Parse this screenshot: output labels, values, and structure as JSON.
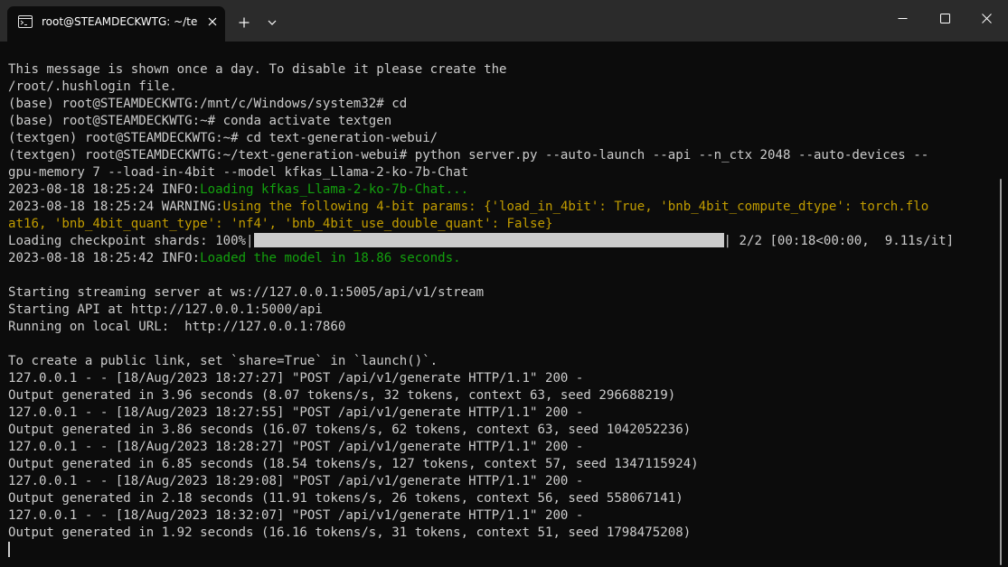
{
  "window": {
    "tab_title": "root@STEAMDECKWTG: ~/tex",
    "icons": {
      "tab": "terminal-icon",
      "close_tab": "close-icon",
      "new_tab": "plus-icon",
      "dropdown": "chevron-down-icon",
      "minimize": "minimize-icon",
      "maximize": "maximize-icon",
      "close_window": "close-icon"
    }
  },
  "terminal": {
    "colors": {
      "text": "#cccccc",
      "green": "#13a10e",
      "yellow": "#c19c00",
      "background": "#0c0c0c"
    },
    "lines": [
      {
        "t": "This message is shown once a day. To disable it please create the"
      },
      {
        "t": "/root/.hushlogin file."
      },
      {
        "t": "(base) root@STEAMDECKWTG:/mnt/c/Windows/system32# cd"
      },
      {
        "t": "(base) root@STEAMDECKWTG:~# conda activate textgen"
      },
      {
        "t": "(textgen) root@STEAMDECKWTG:~# cd text-generation-webui/"
      },
      {
        "t": "(textgen) root@STEAMDECKWTG:~/text-generation-webui# python server.py --auto-launch --api --n_ctx 2048 --auto-devices --"
      },
      {
        "t": "gpu-memory 7 --load-in-4bit --model kfkas_Llama-2-ko-7b-Chat"
      },
      {
        "t": "2023-08-18 18:25:24 INFO:",
        "c": "Loading kfkas_Llama-2-ko-7b-Chat...",
        "cls": "green"
      },
      {
        "t": "2023-08-18 18:25:24 WARNING:",
        "c": "Using the following 4-bit params: {'load_in_4bit': True, 'bnb_4bit_compute_dtype': torch.flo",
        "cls": "yellow"
      },
      {
        "t": "",
        "c": "at16, 'bnb_4bit_quant_type': 'nf4', 'bnb_4bit_use_double_quant': False}",
        "cls": "yellow"
      },
      {
        "progress": true,
        "pre": "Loading checkpoint shards: 100%|",
        "post": "| 2/2 [00:18<00:00,  9.11s/it]"
      },
      {
        "t": "2023-08-18 18:25:42 INFO:",
        "c": "Loaded the model in 18.86 seconds.",
        "cls": "green"
      },
      {
        "t": ""
      },
      {
        "t": "Starting streaming server at ws://127.0.0.1:5005/api/v1/stream"
      },
      {
        "t": "Starting API at http://127.0.0.1:5000/api"
      },
      {
        "t": "Running on local URL:  http://127.0.0.1:7860"
      },
      {
        "t": ""
      },
      {
        "t": "To create a public link, set `share=True` in `launch()`."
      },
      {
        "t": "127.0.0.1 - - [18/Aug/2023 18:27:27] \"POST /api/v1/generate HTTP/1.1\" 200 -"
      },
      {
        "t": "Output generated in 3.96 seconds (8.07 tokens/s, 32 tokens, context 63, seed 296688219)"
      },
      {
        "t": "127.0.0.1 - - [18/Aug/2023 18:27:55] \"POST /api/v1/generate HTTP/1.1\" 200 -"
      },
      {
        "t": "Output generated in 3.86 seconds (16.07 tokens/s, 62 tokens, context 63, seed 1042052236)"
      },
      {
        "t": "127.0.0.1 - - [18/Aug/2023 18:28:27] \"POST /api/v1/generate HTTP/1.1\" 200 -"
      },
      {
        "t": "Output generated in 6.85 seconds (18.54 tokens/s, 127 tokens, context 57, seed 1347115924)"
      },
      {
        "t": "127.0.0.1 - - [18/Aug/2023 18:29:08] \"POST /api/v1/generate HTTP/1.1\" 200 -"
      },
      {
        "t": "Output generated in 2.18 seconds (11.91 tokens/s, 26 tokens, context 56, seed 558067141)"
      },
      {
        "t": "127.0.0.1 - - [18/Aug/2023 18:32:07] \"POST /api/v1/generate HTTP/1.1\" 200 -"
      },
      {
        "t": "Output generated in 1.92 seconds (16.16 tokens/s, 31 tokens, context 51, seed 1798475208)"
      },
      {
        "cursor": true
      }
    ],
    "progress_percent": 100
  }
}
